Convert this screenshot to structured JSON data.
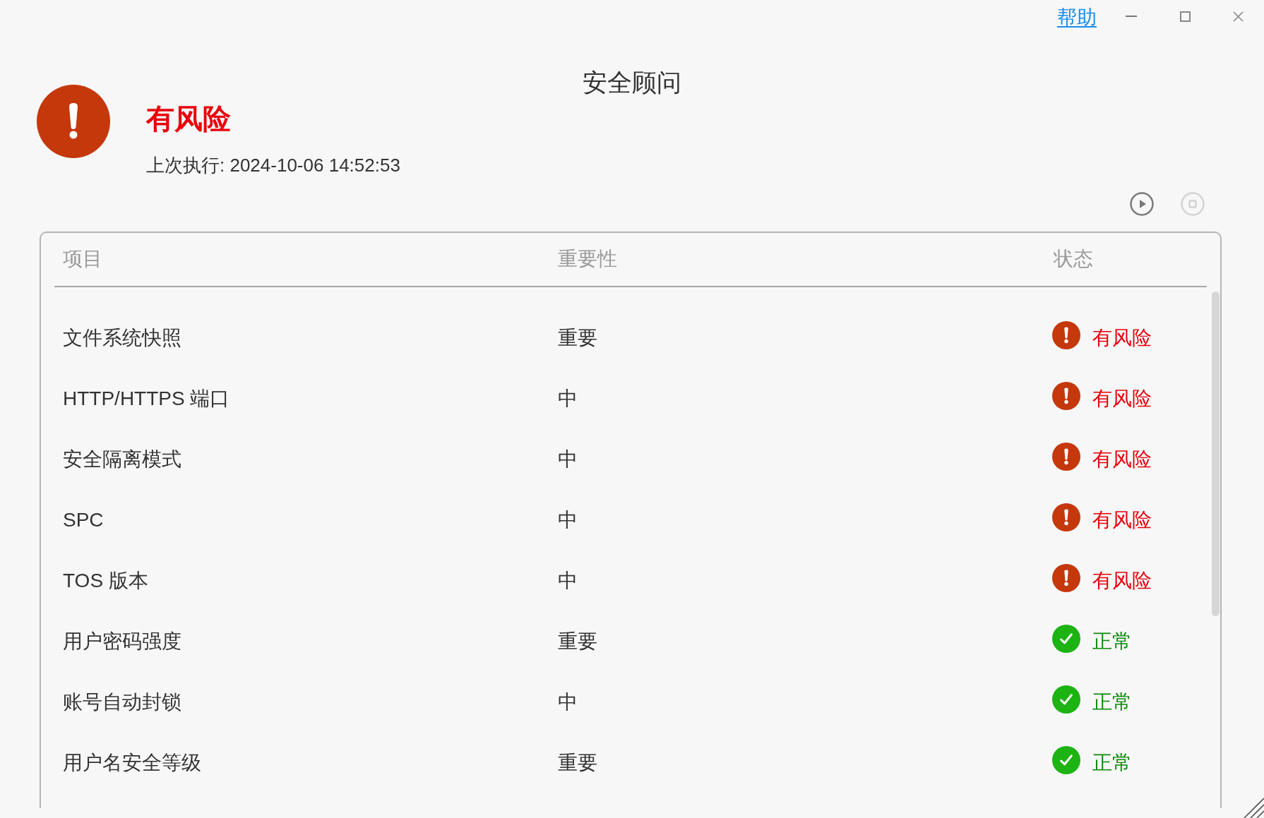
{
  "window": {
    "help_link": "帮助",
    "title": "安全顾问"
  },
  "summary": {
    "kind": "risk",
    "label": "有风险",
    "last_run": "上次执行: 2024-10-06 14:52:53"
  },
  "toolbar": [
    {
      "kind": "run",
      "disabled": false
    },
    {
      "kind": "stop",
      "disabled": true
    }
  ],
  "table": {
    "columns": [
      "项目",
      "重要性",
      "状态"
    ],
    "rows": [
      {
        "item": "文件系统快照",
        "importance": "重要",
        "status": {
          "kind": "risk",
          "label": "有风险"
        }
      },
      {
        "item": "HTTP/HTTPS 端口",
        "importance": "中",
        "status": {
          "kind": "risk",
          "label": "有风险"
        }
      },
      {
        "item": "安全隔离模式",
        "importance": "中",
        "status": {
          "kind": "risk",
          "label": "有风险"
        }
      },
      {
        "item": "SPC",
        "importance": "中",
        "status": {
          "kind": "risk",
          "label": "有风险"
        }
      },
      {
        "item": "TOS 版本",
        "importance": "中",
        "status": {
          "kind": "risk",
          "label": "有风险"
        }
      },
      {
        "item": "用户密码强度",
        "importance": "重要",
        "status": {
          "kind": "ok",
          "label": "正常"
        }
      },
      {
        "item": "账号自动封锁",
        "importance": "中",
        "status": {
          "kind": "ok",
          "label": "正常"
        }
      },
      {
        "item": "用户名安全等级",
        "importance": "重要",
        "status": {
          "kind": "ok",
          "label": "正常"
        }
      }
    ]
  }
}
